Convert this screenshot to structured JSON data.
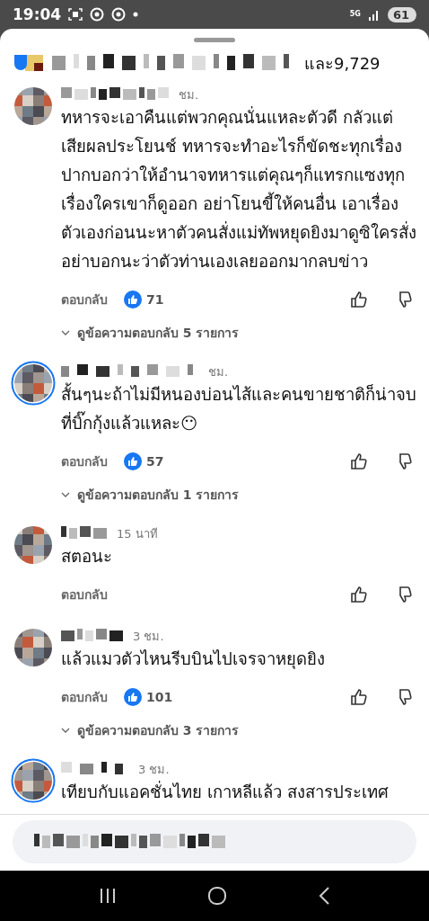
{
  "status_bar": {
    "time": "19:04",
    "network": "5G",
    "battery": "61"
  },
  "reactions_summary": {
    "others": "และ9,729"
  },
  "comments": [
    {
      "time": "ชม.",
      "story_ring": false,
      "text": "ทหารจะเอาคืนแต่พวกคุณนั่นแหละตัวดี กลัวแต่เสียผลประโยนช์ ทหารจะทำอะไรก็ขัดชะทุกเรื่อง ปากบอกว่าให้อำนาจทหารแต่คุณๆก็แทรกแซงทุกเรื่องใครเขาก็ดูออก อย่าโยนขี้ให้คนอื่น เอาเรื่องตัวเองก่อนนะหาตัวคนสั่งแม่ทัพหยุดยิงมาดูซิใครสั่ง  อย่าบอกนะว่าตัวท่านเองเลยออกมากลบข่าว",
      "reply": "ตอบกลับ",
      "likes": "71",
      "replies_link": "ดูข้อความตอบกลับ 5 รายการ"
    },
    {
      "time": "ชม.",
      "story_ring": true,
      "text": "สั้นๆนะถ้าไม่มีหนองบ่อนไส้และคนขายชาติก็น่าจบที่บิ๊กกุ้งแล้วแหละ😶",
      "reply": "ตอบกลับ",
      "likes": "57",
      "replies_link": "ดูข้อความตอบกลับ 1 รายการ"
    },
    {
      "time": "15 นาที",
      "story_ring": false,
      "text": "สตอนะ",
      "reply": "ตอบกลับ"
    },
    {
      "time": "3 ชม.",
      "story_ring": false,
      "text": "แล้วแมวตัวไหนรีบบินไปเจรจาหยุดยิง",
      "reply": "ตอบกลับ",
      "likes": "101",
      "replies_link": "ดูข้อความตอบกลับ 3 รายการ"
    },
    {
      "time": "3 ชม.",
      "story_ring": true,
      "text": "เทียบกับแอคชั่นไทย เกาหลีแล้ว สงสารประเทศ"
    }
  ]
}
